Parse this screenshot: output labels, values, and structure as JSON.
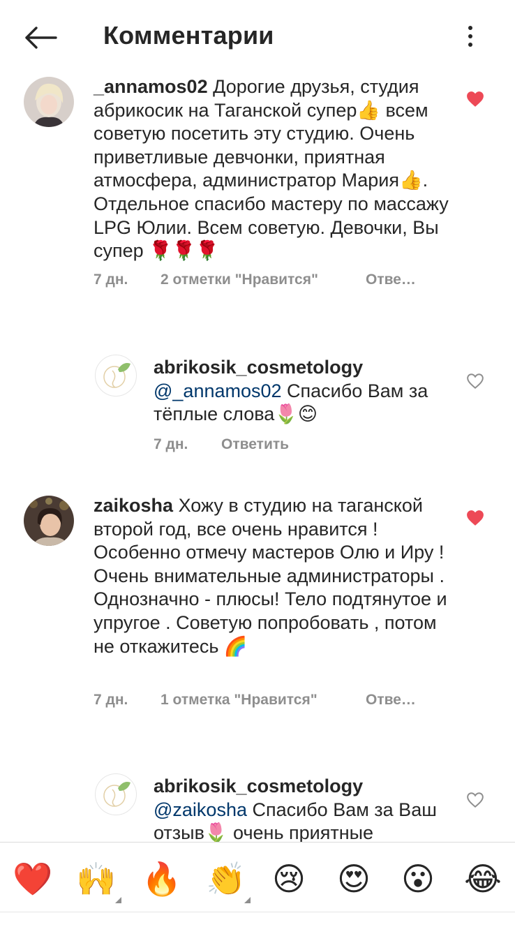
{
  "header": {
    "title": "Комментарии"
  },
  "comments": [
    {
      "username": "_annamos02",
      "text": "Дорогие друзья, студия абрикосик на Таганской супер👍 всем советую посетить эту студию. Очень приветливые девчонки, приятная атмосфера, администратор Мария👍. Отдельное спасибо мастеру по массажу LPG Юлии. Всем советую. Девочки, Вы супер 🌹🌹🌹",
      "time": "7 дн.",
      "likes": "2 отметки \"Нравится\"",
      "reply": "Отве…",
      "liked": true
    },
    {
      "username": "abrikosik_cosmetology",
      "mention": "@_annamos02",
      "text": "Спасибо Вам за тёплые слова🌷😊",
      "time": "7 дн.",
      "reply": "Ответить",
      "liked": false
    },
    {
      "username": "zaikosha",
      "text": "Хожу в студию на таганской второй год, все очень нравится ! Особенно отмечу мастеров Олю и Иру ! Очень внимательные администраторы .  Однозначно - плюсы! Тело подтянутое  и упругое . Советую попробовать , потом не откажитесь 🌈",
      "time": "7 дн.",
      "likes": "1 отметка \"Нравится\"",
      "reply": "Отве…",
      "liked": true
    },
    {
      "username": "abrikosik_cosmetology",
      "mention": "@zaikosha",
      "text": "Спасибо Вам за Ваш отзыв🌷 очень приятные",
      "liked": false
    }
  ],
  "reactions": [
    "❤️",
    "🙌",
    "🔥",
    "👏",
    "😢",
    "😍",
    "😮",
    "😂"
  ],
  "colors": {
    "like_red": "#ed4956",
    "mention_blue": "#00376b",
    "meta_gray": "#8e8e8e",
    "text": "#262626"
  }
}
